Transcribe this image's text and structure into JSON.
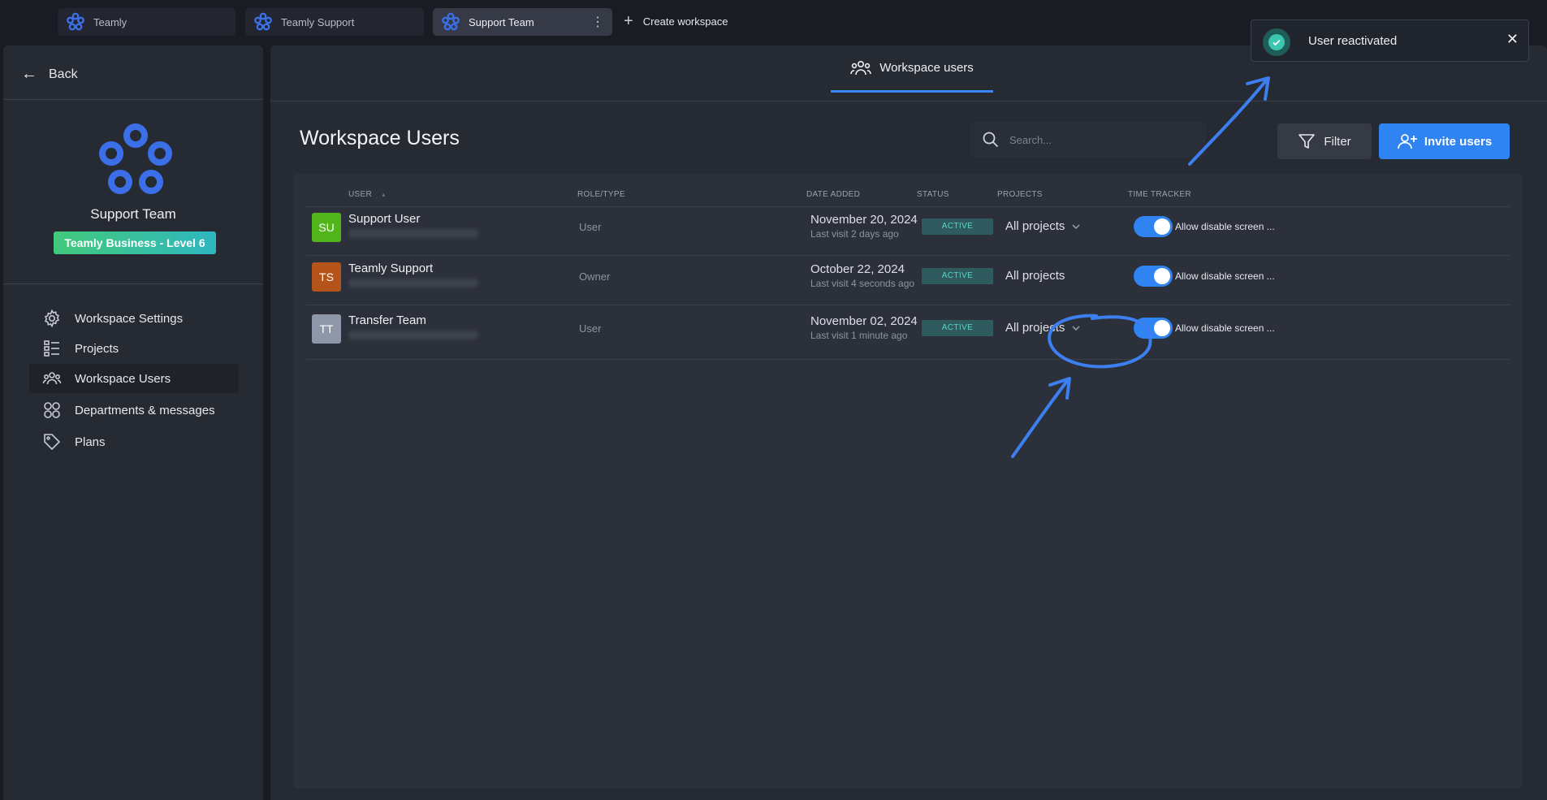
{
  "workspace_tabs": [
    {
      "label": "Teamly"
    },
    {
      "label": "Teamly Support"
    },
    {
      "label": "Support Team"
    }
  ],
  "create_workspace_label": "Create workspace",
  "sidebar": {
    "back_label": "Back",
    "team_name": "Support Team",
    "plan_badge": "Teamly Business - Level 6",
    "items": [
      {
        "label": "Workspace Settings",
        "icon": "gear-icon"
      },
      {
        "label": "Projects",
        "icon": "list-icon"
      },
      {
        "label": "Workspace Users",
        "icon": "users-icon",
        "active": true
      },
      {
        "label": "Departments & messages",
        "icon": "grid-icon"
      },
      {
        "label": "Plans",
        "icon": "tag-icon"
      }
    ]
  },
  "main": {
    "tab_label": "Workspace users",
    "title": "Workspace Users",
    "search_placeholder": "Search...",
    "filter_label": "Filter",
    "invite_label": "Invite users"
  },
  "table": {
    "headers": {
      "user": "USER",
      "sort_indicator": "▴",
      "role": "ROLE/TYPE",
      "date_added": "DATE ADDED",
      "status": "STATUS",
      "projects": "PROJECTS",
      "time_tracker": "TIME TRACKER"
    },
    "rows": [
      {
        "initials": "SU",
        "avatar_color": "#52b51b",
        "name": "Support User",
        "role": "User",
        "date": "November 20, 2024",
        "last_visit": "Last visit 2 days ago",
        "status": "ACTIVE",
        "projects": "All projects",
        "has_dropdown": true,
        "time_tracker_on": true,
        "tt_label": "Allow disable screen ..."
      },
      {
        "initials": "TS",
        "avatar_color": "#b5541a",
        "name": "Teamly Support",
        "role": "Owner",
        "date": "October 22, 2024",
        "last_visit": "Last visit 4 seconds ago",
        "status": "ACTIVE",
        "projects": "All projects",
        "has_dropdown": false,
        "time_tracker_on": true,
        "tt_label": "Allow disable screen ..."
      },
      {
        "initials": "TT",
        "avatar_color": "#8e97a8",
        "name": "Transfer Team",
        "role": "User",
        "date": "November 02, 2024",
        "last_visit": "Last visit 1 minute ago",
        "status": "ACTIVE",
        "projects": "All projects",
        "has_dropdown": true,
        "time_tracker_on": true,
        "tt_label": "Allow disable screen ..."
      }
    ]
  },
  "toast": {
    "message": "User reactivated",
    "close": "✕"
  },
  "colors": {
    "accent": "#2f84f1",
    "status_bg": "#2f5a5e",
    "status_text": "#58d6c4",
    "annotation": "#3c7ff0"
  }
}
